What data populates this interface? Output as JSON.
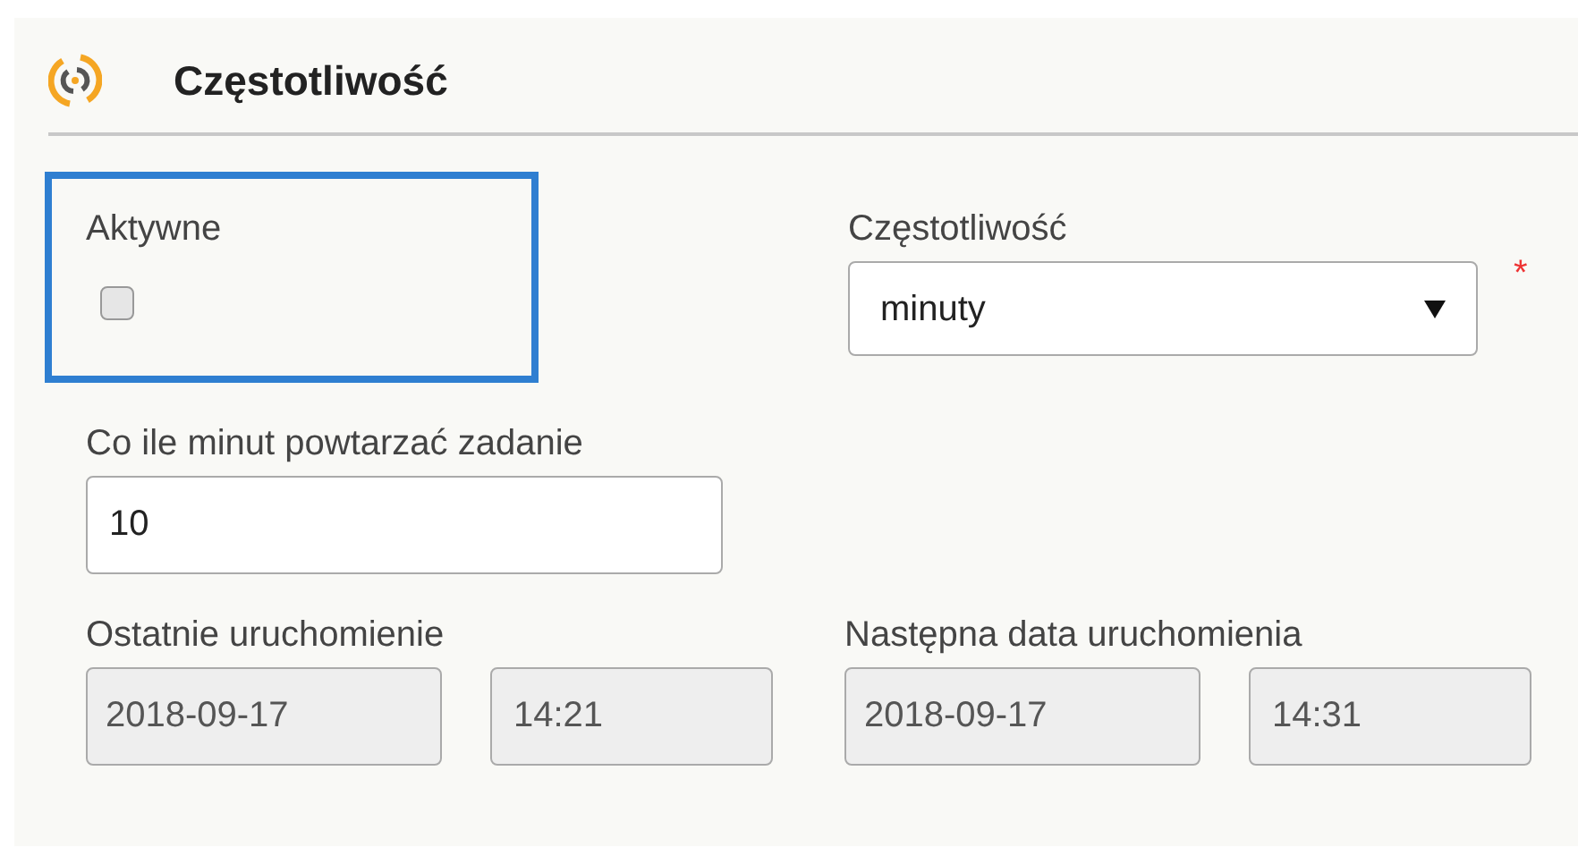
{
  "section": {
    "title": "Częstotliwość"
  },
  "active": {
    "label": "Aktywne",
    "checked": false
  },
  "frequency": {
    "label": "Częstotliwość",
    "value": "minuty",
    "required_mark": "*"
  },
  "interval": {
    "label": "Co ile minut powtarzać zadanie",
    "value": "10"
  },
  "last_run": {
    "label": "Ostatnie uruchomienie",
    "date": "2018-09-17",
    "time": "14:21",
    "disabled": true
  },
  "next_run": {
    "label": "Następna data uruchomienia",
    "date": "2018-09-17",
    "time": "14:31",
    "disabled": true
  }
}
